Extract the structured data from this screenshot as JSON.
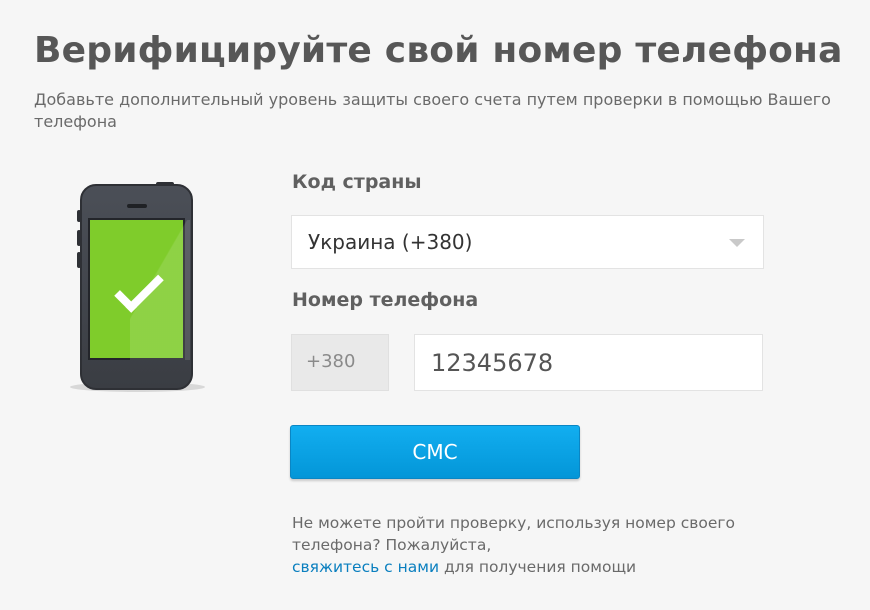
{
  "header": {
    "title": "Верифицируйте свой номер телефона",
    "subtitle": "Добавьте дополнительный уровень защиты своего счета путем проверки в помощью Вашего телефона"
  },
  "illustration": {
    "icon": "phone-check-icon",
    "screen_color": "#7fcc2b"
  },
  "form": {
    "country_label": "Код страны",
    "country_value": "Украина (+380)",
    "phone_label": "Номер телефона",
    "phone_prefix": "+380",
    "phone_value": "12345678",
    "submit_label": "СМС"
  },
  "help": {
    "text_before": "Не можете пройти проверку, используя номер своего телефона? Пожалуйста,",
    "link_text": "свяжитесь с нами",
    "text_after": " для получения помощи"
  },
  "colors": {
    "accent": "#0a9ee0",
    "link": "#0a7fbf",
    "background": "#f6f6f6"
  }
}
